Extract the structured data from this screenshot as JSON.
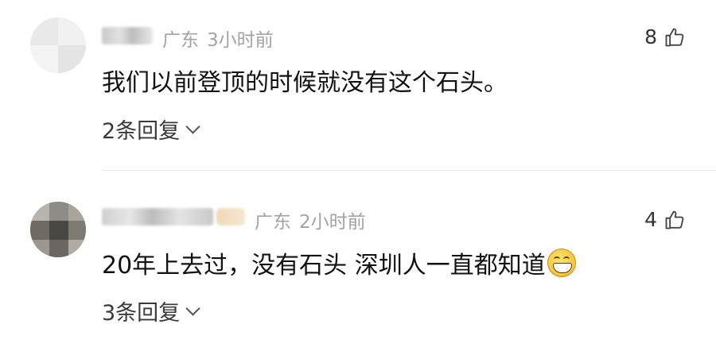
{
  "comments": [
    {
      "location": "广东",
      "time": "3小时前",
      "text": "我们以前登顶的时候就没有这个石头。",
      "replies_label": "2条回复",
      "likes": "8",
      "icons": {
        "like": "thumbs-up-icon",
        "expand": "chevron-down-icon"
      }
    },
    {
      "location": "广东",
      "time": "2小时前",
      "text": "20年上去过，没有石头 深圳人一直都知道",
      "emoji": "grinning-face-icon",
      "replies_label": "3条回复",
      "likes": "4",
      "icons": {
        "like": "thumbs-up-icon",
        "expand": "chevron-down-icon"
      }
    }
  ],
  "colors": {
    "meta_text": "#a3a3a3",
    "body_text": "#121212",
    "divider": "#ececec",
    "background": "#ffffff"
  }
}
